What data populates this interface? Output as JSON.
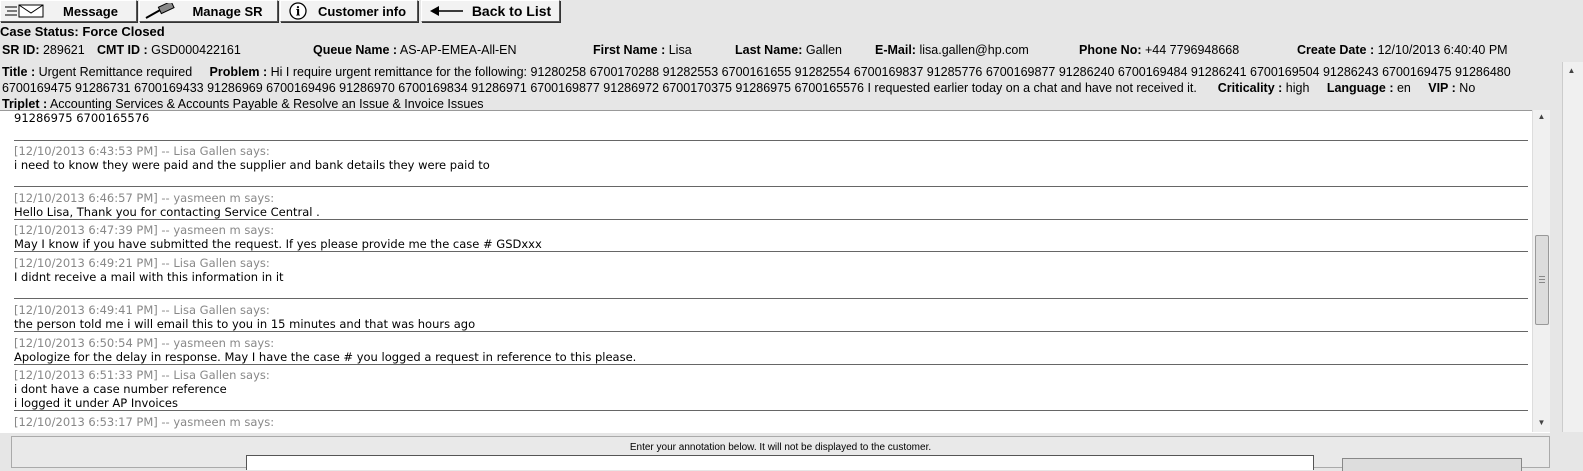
{
  "toolbar": {
    "message_label": "Message",
    "manage_sr_label": "Manage SR",
    "customer_info_label": "Customer info",
    "back_label": "Back to List",
    "info_glyph": "i"
  },
  "case": {
    "status_label": "Case Status:",
    "status_value": "Force Closed",
    "sr_id_label": "SR ID:",
    "sr_id_value": "289621",
    "cmt_id_label": "CMT ID :",
    "cmt_id_value": "GSD000422161",
    "queue_label": "Queue Name :",
    "queue_value": "AS-AP-EMEA-All-EN",
    "first_name_label": "First Name :",
    "first_name_value": "Lisa",
    "last_name_label": "Last Name:",
    "last_name_value": "Gallen",
    "email_label": "E-Mail:",
    "email_value": "lisa.gallen@hp.com",
    "phone_label": "Phone No:",
    "phone_value": "+44 7796948668",
    "create_date_label": "Create Date :",
    "create_date_value": "12/10/2013 6:40:40 PM",
    "title_label": "Title :",
    "title_value": "Urgent Remittance required",
    "problem_label": "Problem :",
    "problem_value": "Hi I require urgent remittance for the following: 91280258 6700170288 91282553 6700161655 91282554 6700169837 91285776 6700169877 91286240 6700169484 91286241 6700169504 91286243 6700169475 91286480 6700169475 91286731 6700169433 91286969 6700169496 91286970 6700169834 91286971 6700169877 91286972 6700170375 91286975 6700165576 I requested earlier today on a chat and have not received it.",
    "criticality_label": "Criticality :",
    "criticality_value": "high",
    "language_label": "Language :",
    "language_value": "en",
    "vip_label": "VIP :",
    "vip_value": "No",
    "triplet_label": "Triplet :",
    "triplet_value": "Accounting Services & Accounts Payable & Resolve an Issue & Invoice Issues"
  },
  "chat": {
    "first_fragment": "91286975 6700165576",
    "messages": [
      {
        "meta": "[12/10/2013 6:43:53 PM] -- Lisa Gallen says:",
        "text": "i need to know they were paid and the supplier and bank details they were paid to"
      },
      {
        "meta": "[12/10/2013 6:46:57 PM] -- yasmeen m says:",
        "text": "Hello Lisa, Thank you for contacting Service Central ."
      },
      {
        "meta": "[12/10/2013 6:47:39 PM] -- yasmeen m says:",
        "text": "May I know if you have submitted the request. If yes please provide me the case # GSDxxx"
      },
      {
        "meta": "[12/10/2013 6:49:21 PM] -- Lisa Gallen says:",
        "text": "I didnt receive a mail with this information in it"
      },
      {
        "meta": "[12/10/2013 6:49:41 PM] -- Lisa Gallen says:",
        "text": "the person told me i will email this to you in 15 minutes and that was hours ago"
      },
      {
        "meta": "[12/10/2013 6:50:54 PM] -- yasmeen m says:",
        "text": "Apologize for the delay in response. May I have the case # you logged a request in reference to this please."
      },
      {
        "meta": "[12/10/2013 6:51:33 PM] -- Lisa Gallen says:",
        "text": "i dont have a case number reference",
        "text2": "i logged it under AP Invoices"
      },
      {
        "meta": "[12/10/2013 6:53:17 PM] -- yasmeen m says:",
        "text": ""
      }
    ]
  },
  "annotation": {
    "note": "Enter your annotation below. It will not be displayed to the customer."
  },
  "icons": {
    "message": "envelope-icon",
    "manage_sr": "gavel-icon",
    "customer_info": "info-circle-icon",
    "back": "left-arrow-icon"
  }
}
